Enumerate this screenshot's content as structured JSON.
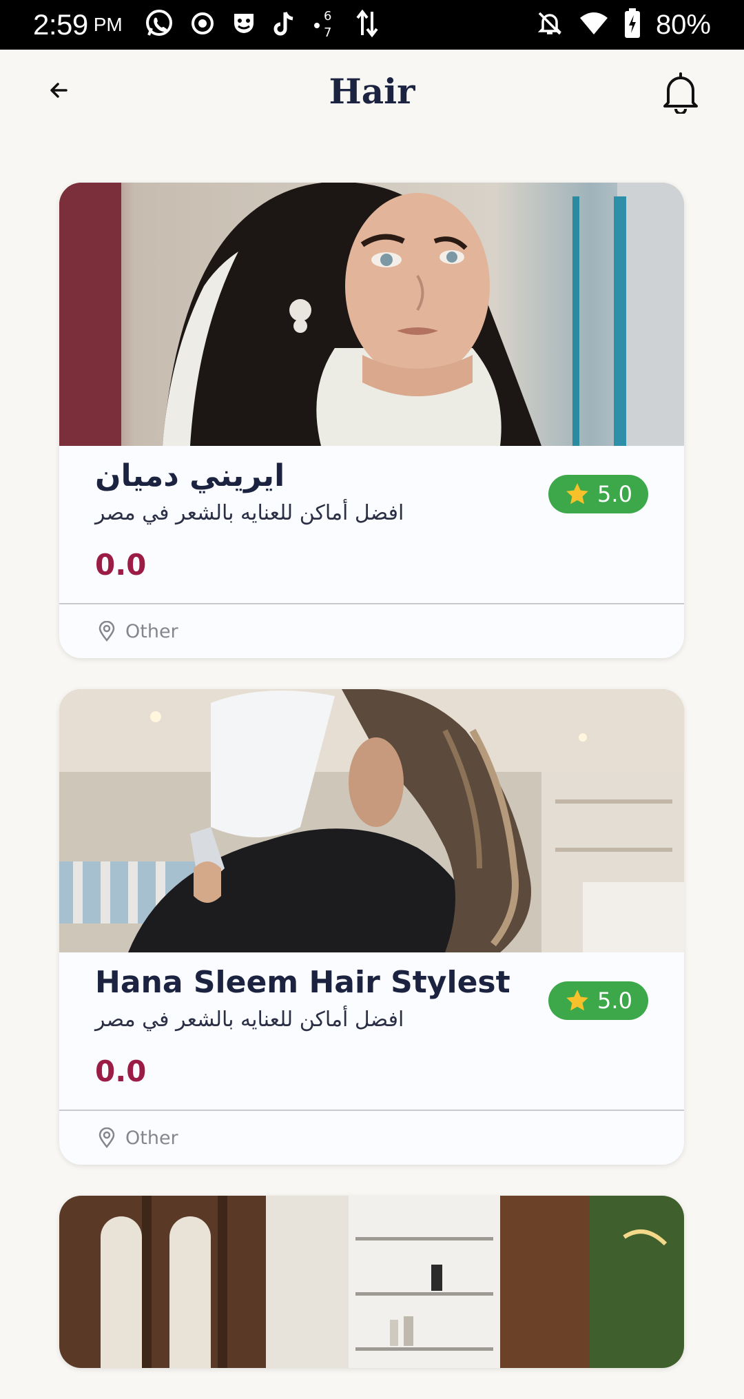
{
  "status_bar": {
    "time": "2:59",
    "ampm": "PM",
    "battery_percent": "80%",
    "icons_left": [
      "whatsapp-icon",
      "record-icon",
      "mask-icon",
      "tiktok-icon",
      "data-6-7-icon",
      "data-arrows-icon"
    ],
    "icons_right": [
      "notifications-off-icon",
      "wifi-icon",
      "battery-charging-icon"
    ]
  },
  "header": {
    "title": "Hair",
    "back_icon": "arrow-left-icon",
    "bell_icon": "bell-icon"
  },
  "colors": {
    "background": "#f9f7f3",
    "title": "#1b2340",
    "price": "#9b1c44",
    "rating_badge": "#3ca84a",
    "star": "#f6c12a",
    "footer_text": "#85868d"
  },
  "cards": [
    {
      "name": "ايريني دميان",
      "subtitle": "افضل أماكن للعنايه بالشعر في مصر",
      "price": "0.0",
      "rating": "5.0",
      "location": "Other"
    },
    {
      "name": "Hana Sleem Hair Stylest",
      "subtitle": "افضل أماكن للعنايه بالشعر في مصر",
      "price": "0.0",
      "rating": "5.0",
      "location": "Other"
    }
  ]
}
